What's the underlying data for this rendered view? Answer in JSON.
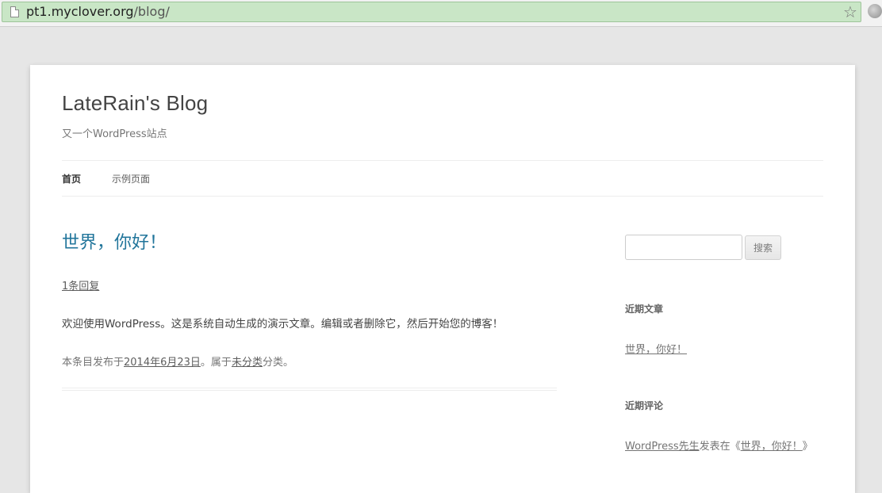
{
  "browser": {
    "url_host": "pt1.myclover.org",
    "url_path": "/blog/"
  },
  "site": {
    "title": "LateRain's Blog",
    "description": "又一个WordPress站点"
  },
  "nav": {
    "items": [
      {
        "label": "首页"
      },
      {
        "label": "示例页面"
      }
    ]
  },
  "post": {
    "title": "世界，你好！",
    "comments_link": "1条回复",
    "content": "欢迎使用WordPress。这是系统自动生成的演示文章。编辑或者删除它，然后开始您的博客！",
    "meta_prefix": "本条目发布于",
    "meta_date": "2014年6月23日",
    "meta_middle": "。属于",
    "meta_category": "未分类",
    "meta_suffix": "分类。"
  },
  "sidebar": {
    "search": {
      "placeholder": "",
      "button_label": "搜索"
    },
    "recent_posts": {
      "title": "近期文章",
      "items": [
        {
          "label": "世界，你好！"
        }
      ]
    },
    "recent_comments": {
      "title": "近期评论",
      "author": "WordPress先生",
      "verb": "发表在《",
      "post": "世界，你好！",
      "close": "》"
    }
  }
}
